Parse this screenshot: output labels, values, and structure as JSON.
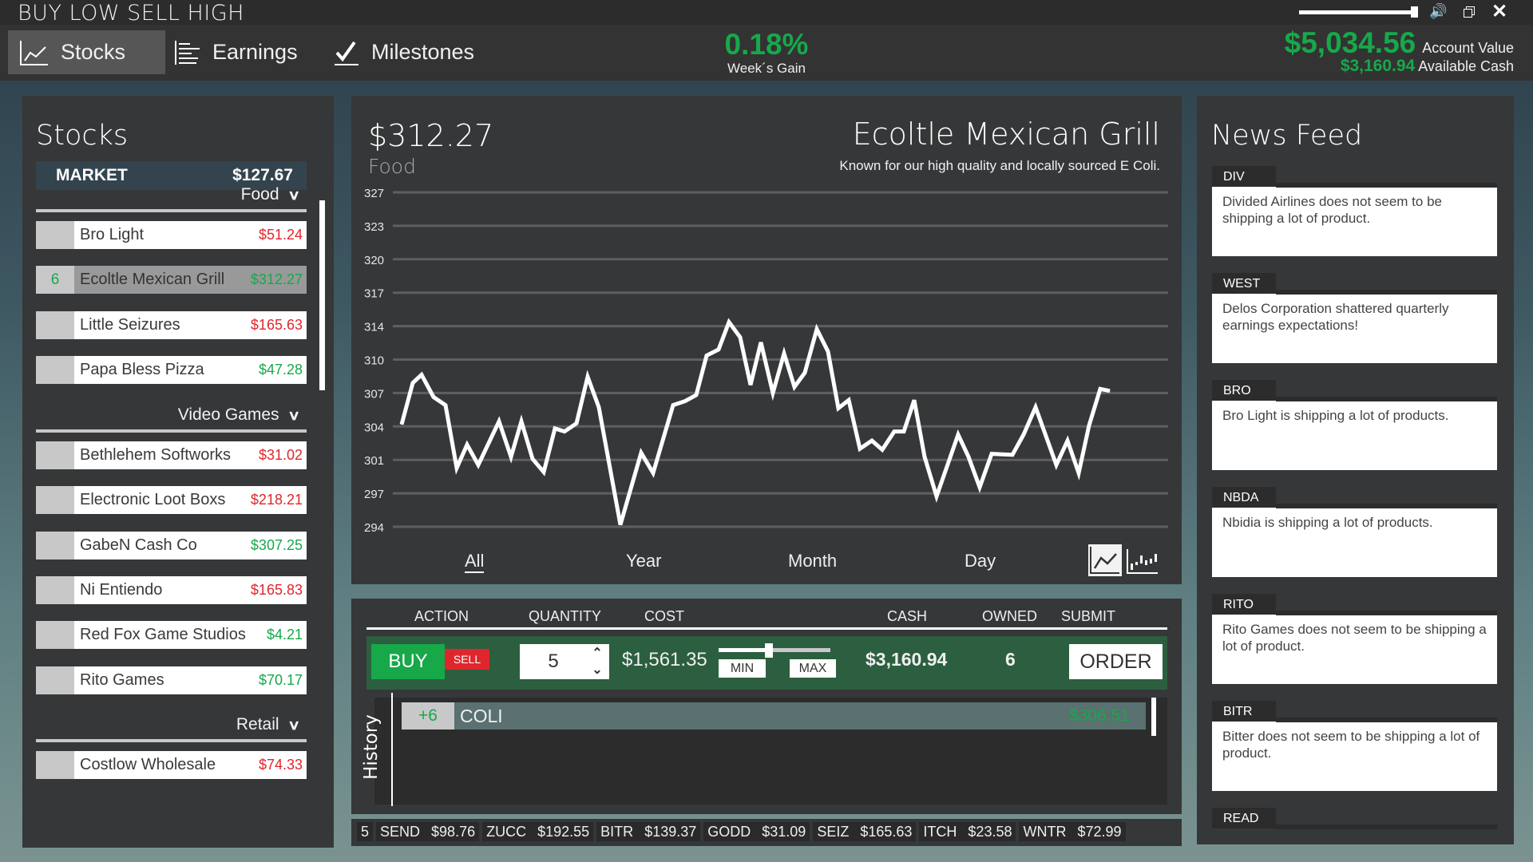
{
  "app": {
    "title": "BUY LOW SELL HIGH",
    "volume_level": 0.95
  },
  "nav": {
    "tabs": [
      {
        "label": "Stocks",
        "icon": "line-chart-icon",
        "active": true
      },
      {
        "label": "Earnings",
        "icon": "bar-list-icon",
        "active": false
      },
      {
        "label": "Milestones",
        "icon": "checkmark-icon",
        "active": false
      }
    ]
  },
  "summary": {
    "weeks_gain": "0.18%",
    "weeks_gain_label": "Week´s Gain",
    "account_value": "$5,034.56",
    "account_value_label": "Account Value",
    "available_cash": "$3,160.94",
    "available_cash_label": "Available Cash"
  },
  "stocks_panel": {
    "title": "Stocks",
    "market_label": "MARKET",
    "market_value": "$127.67",
    "categories": [
      {
        "name": "Food",
        "stocks": [
          {
            "owned": "",
            "name": "Bro Light",
            "price": "$51.24",
            "trend": "down",
            "selected": false
          },
          {
            "owned": "6",
            "name": "Ecoltle Mexican Grill",
            "price": "$312.27",
            "trend": "up",
            "selected": true
          },
          {
            "owned": "",
            "name": "Little Seizures",
            "price": "$165.63",
            "trend": "down",
            "selected": false
          },
          {
            "owned": "",
            "name": "Papa Bless Pizza",
            "price": "$47.28",
            "trend": "up",
            "selected": false
          }
        ]
      },
      {
        "name": "Video Games",
        "stocks": [
          {
            "owned": "",
            "name": "Bethlehem Softworks",
            "price": "$31.02",
            "trend": "down",
            "selected": false
          },
          {
            "owned": "",
            "name": "Electronic Loot Boxs",
            "price": "$218.21",
            "trend": "down",
            "selected": false
          },
          {
            "owned": "",
            "name": "GabeN Cash Co",
            "price": "$307.25",
            "trend": "up",
            "selected": false
          },
          {
            "owned": "",
            "name": "Ni Entiendo",
            "price": "$165.83",
            "trend": "down",
            "selected": false
          },
          {
            "owned": "",
            "name": "Red Fox Game Studios",
            "price": "$4.21",
            "trend": "up",
            "selected": false
          },
          {
            "owned": "",
            "name": "Rito Games",
            "price": "$70.17",
            "trend": "up",
            "selected": false
          }
        ]
      },
      {
        "name": "Retail",
        "stocks": [
          {
            "owned": "",
            "name": "Costlow Wholesale",
            "price": "$74.33",
            "trend": "down",
            "selected": false
          }
        ]
      }
    ]
  },
  "detail": {
    "price": "$312.27",
    "sector": "Food",
    "company": "Ecoltle Mexican Grill",
    "tagline": "Known for our high quality and locally sourced E Coli.",
    "ranges": [
      {
        "label": "All",
        "active": true
      },
      {
        "label": "Year",
        "active": false
      },
      {
        "label": "Month",
        "active": false
      },
      {
        "label": "Day",
        "active": false
      }
    ],
    "chart_types": [
      {
        "name": "line-chart-type-icon",
        "active": true
      },
      {
        "name": "candlestick-chart-type-icon",
        "active": false
      }
    ]
  },
  "chart_data": {
    "type": "line",
    "title": "Ecoltle Mexican Grill",
    "xlabel": "",
    "ylabel": "",
    "yticks": [
      327,
      323,
      320,
      317,
      314,
      310,
      307,
      304,
      301,
      297,
      294
    ],
    "ylim": [
      294,
      327
    ],
    "grid": true,
    "legend": "none",
    "series": [
      {
        "name": "price",
        "color": "#ffffff",
        "values": [
          304.1,
          308.2,
          309.0,
          306.8,
          306.0,
          299.8,
          302.1,
          300.1,
          304.4,
          300.9,
          304.4,
          300.7,
          299.4,
          303.7,
          303.4,
          304.2,
          308.8,
          305.8,
          294.2,
          301.3,
          299.3,
          306.0,
          306.4,
          307.0,
          310.9,
          311.5,
          314.2,
          312.7,
          308.0,
          312.2,
          307.2,
          311.1,
          307.8,
          309.2,
          313.5,
          311.3,
          305.7,
          306.5,
          301.7,
          302.5,
          301.6,
          303.4,
          303.4,
          306.5,
          300.9,
          297.0,
          303.1,
          300.9,
          297.9,
          301.2,
          301.1,
          303.1,
          305.8,
          300.1,
          302.5,
          299.3,
          304.0,
          307.6,
          307.4
        ],
        "x": [
          0,
          14,
          25,
          40,
          55,
          69,
          82,
          96,
          122,
          137,
          150,
          164,
          178,
          192,
          204,
          219,
          233,
          247,
          274,
          300,
          315,
          340,
          355,
          369,
          382,
          397,
          410,
          424,
          437,
          450,
          465,
          479,
          492,
          505,
          520,
          534,
          547,
          560,
          574,
          589,
          602,
          617,
          629,
          642,
          655,
          670,
          697,
          710,
          724,
          739,
          765,
          779,
          794,
          820,
          834,
          848,
          861,
          875,
          887
        ]
      }
    ]
  },
  "trade": {
    "headers": {
      "action": "ACTION",
      "quantity": "QUANTITY",
      "cost": "COST",
      "cash": "CASH",
      "owned": "OWNED",
      "submit": "SUBMIT"
    },
    "buy_label": "BUY",
    "sell_label": "SELL",
    "quantity": "5",
    "cost": "$1,561.35",
    "slider_fraction": 0.45,
    "min_label": "MIN",
    "max_label": "MAX",
    "cash": "$3,160.94",
    "owned": "6",
    "order_label": "ORDER"
  },
  "history": {
    "label": "History",
    "entries": [
      {
        "qty": "+6",
        "ticker": "COLI",
        "price": "$306.51"
      }
    ]
  },
  "ticker": [
    {
      "symbol": "",
      "price": "5"
    },
    {
      "symbol": "SEND",
      "price": "$98.76"
    },
    {
      "symbol": "ZUCC",
      "price": "$192.55"
    },
    {
      "symbol": "BITR",
      "price": "$139.37"
    },
    {
      "symbol": "GODD",
      "price": "$31.09"
    },
    {
      "symbol": "SEIZ",
      "price": "$165.63"
    },
    {
      "symbol": "ITCH",
      "price": "$23.58"
    },
    {
      "symbol": "WNTR",
      "price": "$72.99"
    }
  ],
  "news": {
    "title": "News Feed",
    "items": [
      {
        "tag": "DIV",
        "text": "Divided Airlines does not seem to be shipping a lot of product."
      },
      {
        "tag": "WEST",
        "text": "Delos Corporation shattered quarterly earnings expectations!"
      },
      {
        "tag": "BRO",
        "text": "Bro Light is shipping a lot of products."
      },
      {
        "tag": "NBDA",
        "text": "Nbidia is shipping a lot of products."
      },
      {
        "tag": "RITO",
        "text": "Rito Games does not seem to be shipping a lot of product."
      },
      {
        "tag": "BITR",
        "text": "Bitter does not seem to be shipping a lot of product."
      },
      {
        "tag": "READ",
        "text": ""
      }
    ]
  }
}
